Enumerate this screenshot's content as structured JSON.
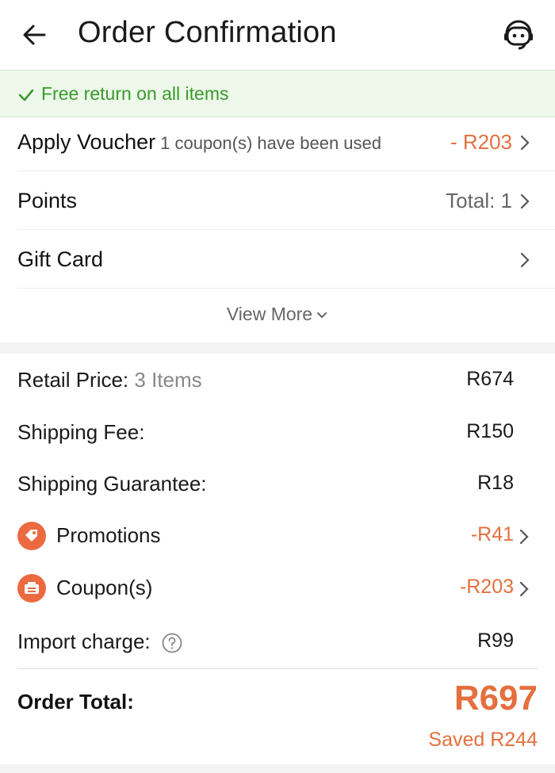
{
  "header": {
    "title": "Order Confirmation"
  },
  "banner": {
    "text": "Free return on all items"
  },
  "options": {
    "voucher": {
      "label": "Apply Voucher",
      "sub": "1 coupon(s) have been used",
      "value": "- R203"
    },
    "points": {
      "label": "Points",
      "value": "Total: 1"
    },
    "gift_card": {
      "label": "Gift Card"
    },
    "view_more": "View More"
  },
  "summary": {
    "retail": {
      "label": "Retail Price:",
      "items": "3 Items",
      "value": "R674"
    },
    "shipping": {
      "label": "Shipping Fee:",
      "value": "R150"
    },
    "guarantee": {
      "label": "Shipping Guarantee:",
      "value": "R18"
    },
    "promotions": {
      "label": "Promotions",
      "value": "-R41"
    },
    "coupons": {
      "label": "Coupon(s)",
      "value": "-R203"
    },
    "import": {
      "label": "Import charge:",
      "value": "R99"
    },
    "total": {
      "label": "Order Total:",
      "value": "R697",
      "saved": "Saved R244"
    }
  },
  "colors": {
    "accent": "#e4703e",
    "success": "#3a9a2c",
    "banner_bg": "#edf8ea"
  }
}
